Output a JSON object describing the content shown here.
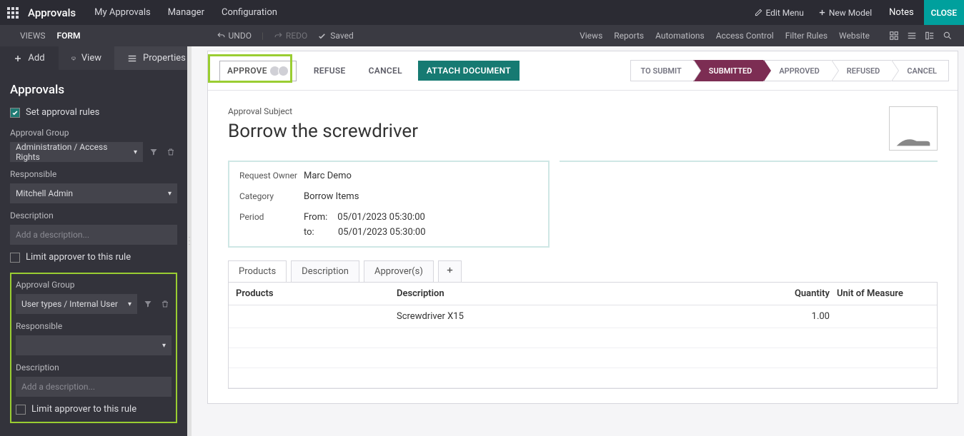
{
  "topbar": {
    "brand": "Approvals",
    "nav": [
      "My Approvals",
      "Manager",
      "Configuration"
    ],
    "edit_menu": "Edit Menu",
    "new_model": "New Model",
    "notes": "Notes",
    "close": "CLOSE"
  },
  "secondbar": {
    "views_label": "VIEWS",
    "form_label": "FORM",
    "undo": "UNDO",
    "redo": "REDO",
    "saved": "Saved",
    "right_links": [
      "Views",
      "Reports",
      "Automations",
      "Access Control",
      "Filter Rules",
      "Website"
    ]
  },
  "sidebar": {
    "tabs": {
      "add": "Add",
      "view": "View",
      "props": "Properties"
    },
    "title": "Approvals",
    "set_rules": "Set approval rules",
    "group1": {
      "group_label": "Approval Group",
      "group_value": "Administration / Access Rights",
      "responsible_label": "Responsible",
      "responsible_value": "Mitchell Admin",
      "description_label": "Description",
      "description_placeholder": "Add a description...",
      "limit_label": "Limit approver to this rule"
    },
    "group2": {
      "group_label": "Approval Group",
      "group_value": "User types / Internal User",
      "responsible_label": "Responsible",
      "responsible_value": "",
      "description_label": "Description",
      "description_placeholder": "Add a description...",
      "limit_label": "Limit approver to this rule"
    }
  },
  "form": {
    "buttons": {
      "approve": "APPROVE",
      "refuse": "REFUSE",
      "cancel": "CANCEL",
      "attach": "ATTACH DOCUMENT"
    },
    "steps": [
      "TO SUBMIT",
      "SUBMITTED",
      "APPROVED",
      "REFUSED",
      "CANCEL"
    ],
    "active_step": 1,
    "subject_label": "Approval Subject",
    "subject": "Borrow the screwdriver",
    "owner_label": "Request Owner",
    "owner": "Marc Demo",
    "category_label": "Category",
    "category": "Borrow Items",
    "period_label": "Period",
    "period_from_lbl": "From:",
    "period_from": "05/01/2023 05:30:00",
    "period_to_lbl": "to:",
    "period_to": "05/01/2023 05:30:00",
    "tabs": [
      "Products",
      "Description",
      "Approver(s)"
    ],
    "active_tab": 0,
    "table": {
      "headers": [
        "Products",
        "Description",
        "Quantity",
        "Unit of Measure"
      ],
      "rows": [
        {
          "product": "",
          "description": "Screwdriver X15",
          "qty": "1.00",
          "uom": ""
        }
      ]
    }
  }
}
